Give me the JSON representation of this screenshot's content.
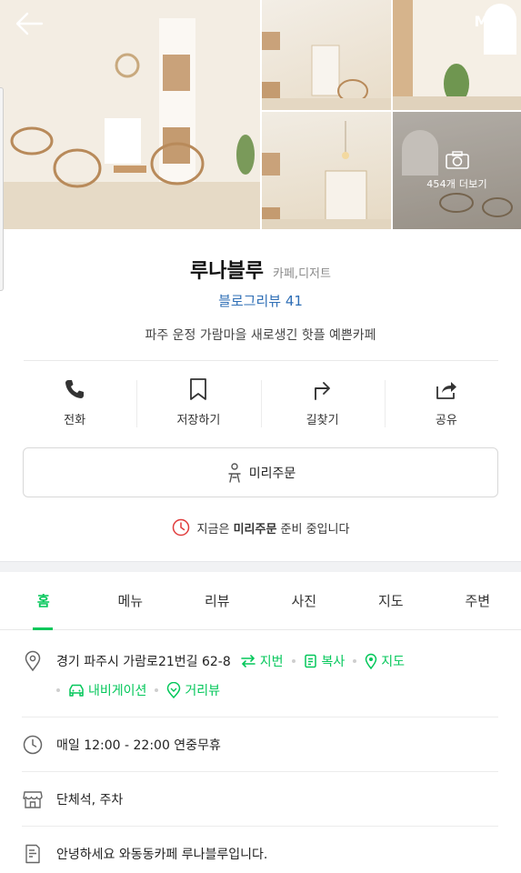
{
  "header": {
    "my_label": "MY"
  },
  "photos": {
    "more_label": "454개 더보기"
  },
  "place": {
    "name": "루나블루",
    "category": "카페,디저트",
    "blog_review": "블로그리뷰 41",
    "description": "파주 운정 가람마을 새로생긴 핫플 예쁜카페"
  },
  "actions": [
    {
      "label": "전화",
      "icon": "phone-icon"
    },
    {
      "label": "저장하기",
      "icon": "bookmark-icon"
    },
    {
      "label": "길찾기",
      "icon": "directions-icon"
    },
    {
      "label": "공유",
      "icon": "share-icon"
    }
  ],
  "preorder": {
    "button_label": "미리주문",
    "notice_prefix": "지금은 ",
    "notice_bold": "미리주문",
    "notice_suffix": " 준비 중입니다"
  },
  "tabs": [
    "홈",
    "메뉴",
    "리뷰",
    "사진",
    "지도",
    "주변"
  ],
  "details": {
    "address": "경기 파주시 가람로21번길 62-8",
    "address_links": [
      "지번",
      "복사",
      "지도"
    ],
    "nav_links": [
      "내비게이션",
      "거리뷰"
    ],
    "hours": "매일 12:00 - 22:00 연중무휴",
    "amenities": "단체석, 주차",
    "intro": "안녕하세요 와동동카페 루나블루입니다."
  },
  "colors": {
    "accent": "#03c75a",
    "link_blue": "#2f6fb6",
    "notice_red": "#e03c3c"
  }
}
